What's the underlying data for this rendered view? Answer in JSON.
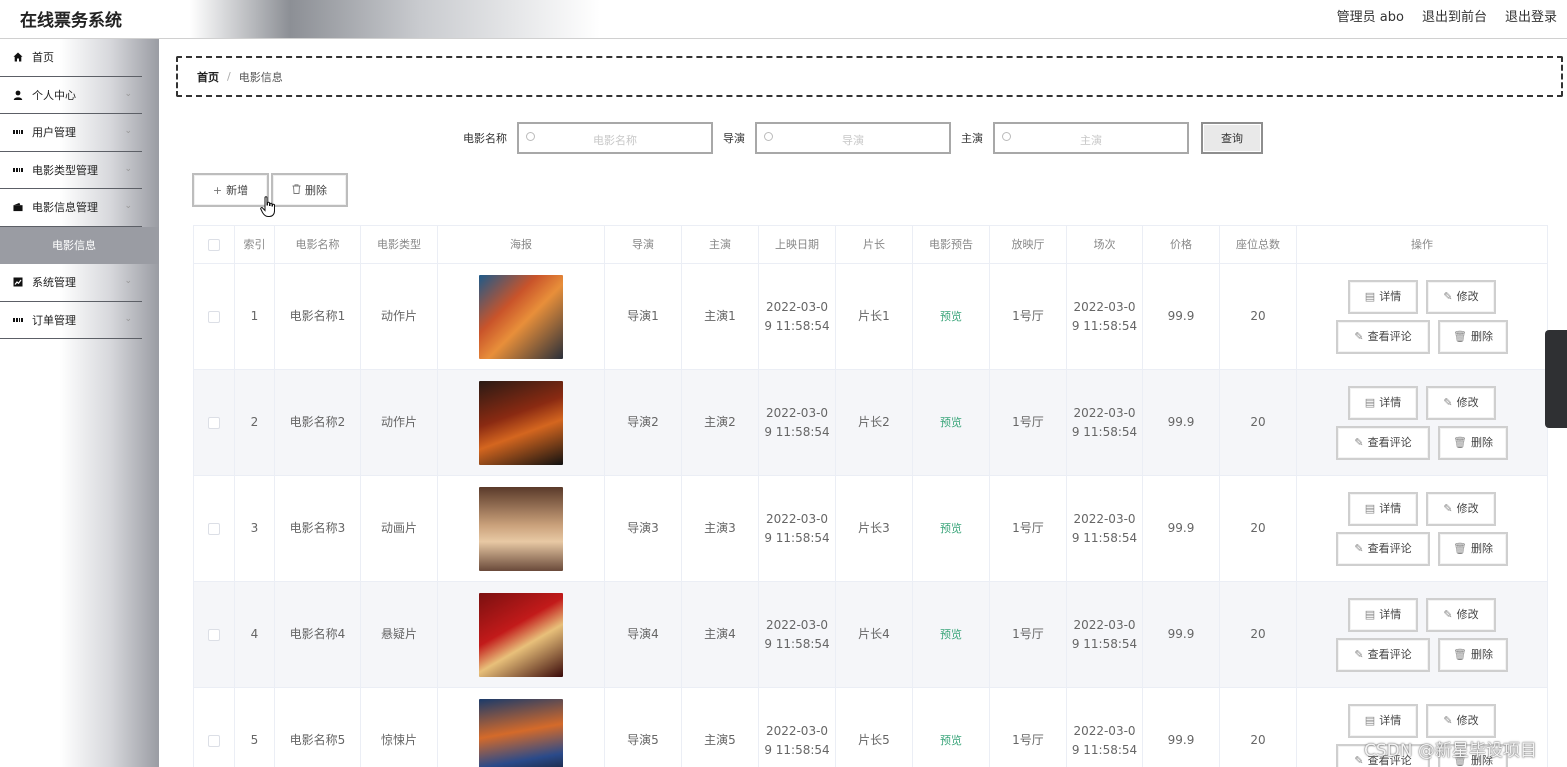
{
  "header": {
    "app_title": "在线票务系统",
    "admin_label": "管理员 abo",
    "to_front": "退出到前台",
    "logout": "退出登录"
  },
  "sidebar": {
    "items": [
      {
        "label": "首页",
        "icon": "home-icon"
      },
      {
        "label": "个人中心",
        "icon": "user-icon"
      },
      {
        "label": "用户管理",
        "icon": "grid-icon"
      },
      {
        "label": "电影类型管理",
        "icon": "grid-icon"
      },
      {
        "label": "电影信息管理",
        "icon": "wallet-icon"
      },
      {
        "label": "电影信息",
        "active": true
      },
      {
        "label": "系统管理",
        "icon": "chart-icon"
      },
      {
        "label": "订单管理",
        "icon": "grid-icon"
      }
    ]
  },
  "breadcrumb": {
    "home": "首页",
    "separator": "/",
    "current": "电影信息"
  },
  "search": {
    "fields": [
      {
        "label": "电影名称",
        "placeholder": "电影名称"
      },
      {
        "label": "导演",
        "placeholder": "导演"
      },
      {
        "label": "主演",
        "placeholder": "主演"
      }
    ],
    "query_label": "查询"
  },
  "toolbar": {
    "add_label": "新增",
    "delete_label": "删除"
  },
  "table": {
    "headers": [
      "索引",
      "电影名称",
      "电影类型",
      "海报",
      "导演",
      "主演",
      "上映日期",
      "片长",
      "电影预告",
      "放映厅",
      "场次",
      "价格",
      "座位总数",
      "操作"
    ],
    "rows": [
      {
        "index": "1",
        "name": "电影名称1",
        "type": "动作片",
        "director": "导演1",
        "actor": "主演1",
        "date_a": "2022-03-0",
        "date_b": "9 11:58:54",
        "duration": "片长1",
        "trailer": "预览",
        "hall": "1号厅",
        "session_a": "2022-03-0",
        "session_b": "9 11:58:54",
        "price": "99.9",
        "seats": "20"
      },
      {
        "index": "2",
        "name": "电影名称2",
        "type": "动作片",
        "director": "导演2",
        "actor": "主演2",
        "date_a": "2022-03-0",
        "date_b": "9 11:58:54",
        "duration": "片长2",
        "trailer": "预览",
        "hall": "1号厅",
        "session_a": "2022-03-0",
        "session_b": "9 11:58:54",
        "price": "99.9",
        "seats": "20"
      },
      {
        "index": "3",
        "name": "电影名称3",
        "type": "动画片",
        "director": "导演3",
        "actor": "主演3",
        "date_a": "2022-03-0",
        "date_b": "9 11:58:54",
        "duration": "片长3",
        "trailer": "预览",
        "hall": "1号厅",
        "session_a": "2022-03-0",
        "session_b": "9 11:58:54",
        "price": "99.9",
        "seats": "20"
      },
      {
        "index": "4",
        "name": "电影名称4",
        "type": "悬疑片",
        "director": "导演4",
        "actor": "主演4",
        "date_a": "2022-03-0",
        "date_b": "9 11:58:54",
        "duration": "片长4",
        "trailer": "预览",
        "hall": "1号厅",
        "session_a": "2022-03-0",
        "session_b": "9 11:58:54",
        "price": "99.9",
        "seats": "20"
      },
      {
        "index": "5",
        "name": "电影名称5",
        "type": "惊悚片",
        "director": "导演5",
        "actor": "主演5",
        "date_a": "2022-03-0",
        "date_b": "9 11:58:54",
        "duration": "片长5",
        "trailer": "预览",
        "hall": "1号厅",
        "session_a": "2022-03-0",
        "session_b": "9 11:58:54",
        "price": "99.9",
        "seats": "20"
      }
    ],
    "ops": {
      "detail": "详情",
      "edit": "修改",
      "comment": "查看评论",
      "delete": "删除"
    }
  },
  "watermark": "CSDN @新星毕设项目",
  "colors": {
    "preview_link": "#3aa57a",
    "active_menu_bg": "#9a9ca3"
  }
}
